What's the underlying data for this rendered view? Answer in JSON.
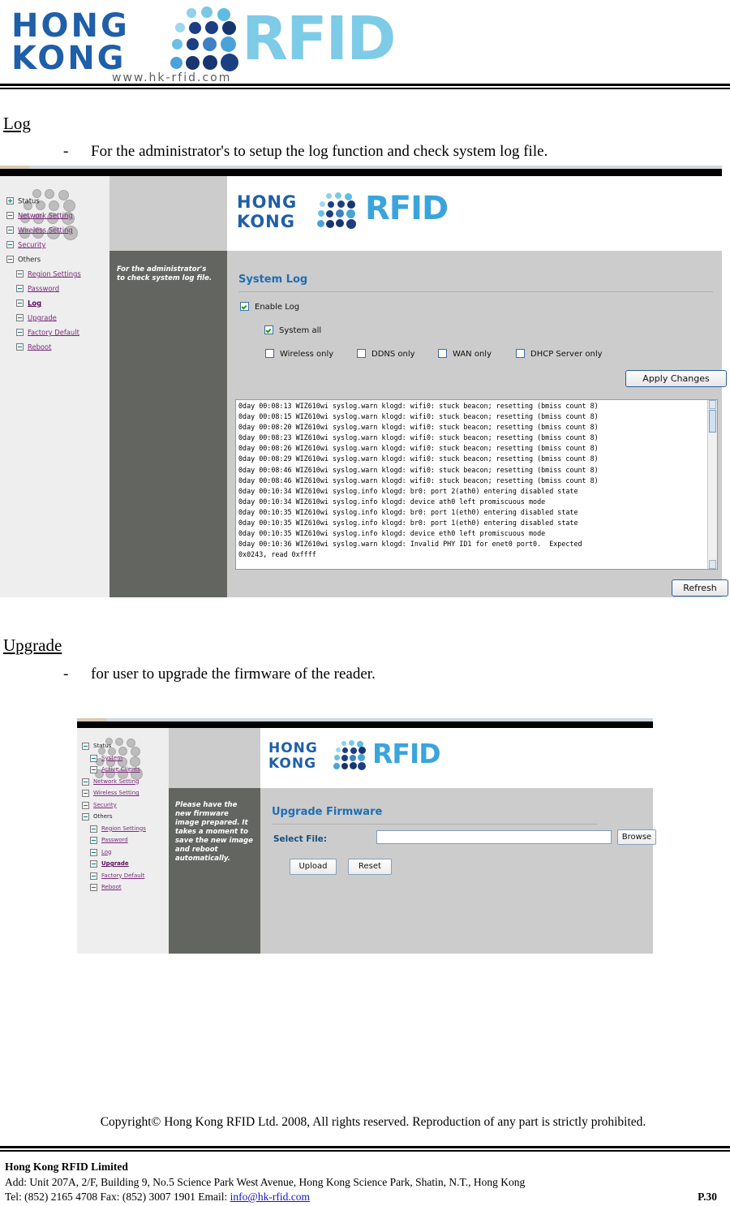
{
  "letterhead": {
    "line1": "HONG",
    "line2": "KONG",
    "brand": "RFID",
    "url": "www.hk-rfid.com"
  },
  "sections": [
    {
      "heading": "Log",
      "bullet_marker": "-",
      "bullet": "For the administrator's to setup the log function and check system log file."
    },
    {
      "heading": "Upgrade",
      "bullet_marker": "-",
      "bullet": "for user to upgrade the firmware of the reader."
    }
  ],
  "log_screenshot": {
    "logo": {
      "line1": "HONG",
      "line2": "KONG",
      "brand": "RFID"
    },
    "nav": [
      {
        "label": "Status",
        "icon": "plus-expand-icon",
        "style": "plain",
        "indent": 0
      },
      {
        "label": "Network Setting",
        "icon": "minus-collapse-icon",
        "style": "link",
        "indent": 0
      },
      {
        "label": "Wireless Setting",
        "icon": "minus-collapse-icon",
        "style": "link",
        "indent": 0
      },
      {
        "label": "Security",
        "icon": "minus-collapse-icon",
        "style": "link",
        "indent": 0
      },
      {
        "label": "Others",
        "icon": "minus-collapse-icon",
        "style": "plain",
        "indent": 0
      },
      {
        "label": "Region Settings",
        "icon": "minus-collapse-icon",
        "style": "link",
        "indent": 1
      },
      {
        "label": "Password",
        "icon": "minus-collapse-icon",
        "style": "link",
        "indent": 1
      },
      {
        "label": "Log",
        "icon": "minus-collapse-icon",
        "style": "current",
        "indent": 1
      },
      {
        "label": "Upgrade",
        "icon": "minus-collapse-icon",
        "style": "link",
        "indent": 1
      },
      {
        "label": "Factory Default",
        "icon": "minus-collapse-icon",
        "style": "link",
        "indent": 1
      },
      {
        "label": "Reboot",
        "icon": "minus-collapse-icon",
        "style": "link",
        "indent": 1
      }
    ],
    "hint": "For the administrator's to check system log file.",
    "panel_title": "System Log",
    "checkboxes": [
      {
        "label": "Enable Log",
        "checked": true
      },
      {
        "label": "System all",
        "checked": true
      },
      {
        "label": "Wireless only",
        "checked": false
      },
      {
        "label": "DDNS only",
        "checked": false
      },
      {
        "label": "WAN only",
        "checked": false
      },
      {
        "label": "DHCP Server only",
        "checked": false
      }
    ],
    "apply_button": "Apply Changes",
    "refresh_button": "Refresh",
    "log_lines": [
      "0day 00:08:13 WIZ610wi syslog.warn klogd: wifi0: stuck beacon; resetting (bmiss count 8)",
      "0day 00:08:15 WIZ610wi syslog.warn klogd: wifi0: stuck beacon; resetting (bmiss count 8)",
      "0day 00:08:20 WIZ610wi syslog.warn klogd: wifi0: stuck beacon; resetting (bmiss count 8)",
      "0day 00:08:23 WIZ610wi syslog.warn klogd: wifi0: stuck beacon; resetting (bmiss count 8)",
      "0day 00:08:26 WIZ610wi syslog.warn klogd: wifi0: stuck beacon; resetting (bmiss count 8)",
      "0day 00:08:29 WIZ610wi syslog.warn klogd: wifi0: stuck beacon; resetting (bmiss count 8)",
      "0day 00:08:46 WIZ610wi syslog.warn klogd: wifi0: stuck beacon; resetting (bmiss count 8)",
      "0day 00:08:46 WIZ610wi syslog.warn klogd: wifi0: stuck beacon; resetting (bmiss count 8)",
      "0day 00:10:34 WIZ610wi syslog.info klogd: br0: port 2(ath0) entering disabled state",
      "0day 00:10:34 WIZ610wi syslog.info klogd: device ath0 left promiscuous mode",
      "0day 00:10:35 WIZ610wi syslog.info klogd: br0: port 1(eth0) entering disabled state",
      "0day 00:10:35 WIZ610wi syslog.info klogd: br0: port 1(eth0) entering disabled state",
      "0day 00:10:35 WIZ610wi syslog.info klogd: device eth0 left promiscuous mode",
      "0day 00:10:36 WIZ610wi syslog.warn klogd: Invalid PHY ID1 for enet0 port0.  Expected",
      "0x0243, read 0xffff"
    ]
  },
  "upgrade_screenshot": {
    "logo": {
      "line1": "HONG",
      "line2": "KONG",
      "brand": "RFID"
    },
    "nav": [
      {
        "label": "Status",
        "icon": "minus-collapse-icon",
        "style": "plain",
        "indent": 0
      },
      {
        "label": "System",
        "icon": "minus-collapse-icon",
        "style": "link",
        "indent": 1
      },
      {
        "label": "Active Clients",
        "icon": "minus-collapse-icon",
        "style": "link",
        "indent": 1
      },
      {
        "label": "Network Setting",
        "icon": "minus-collapse-icon",
        "style": "link",
        "indent": 0
      },
      {
        "label": "Wireless Setting",
        "icon": "minus-collapse-icon",
        "style": "link",
        "indent": 0
      },
      {
        "label": "Security",
        "icon": "minus-collapse-icon",
        "style": "link",
        "indent": 0
      },
      {
        "label": "Others",
        "icon": "minus-collapse-icon",
        "style": "plain",
        "indent": 0
      },
      {
        "label": "Region Settings",
        "icon": "minus-collapse-icon",
        "style": "link",
        "indent": 1
      },
      {
        "label": "Password",
        "icon": "minus-collapse-icon",
        "style": "link",
        "indent": 1
      },
      {
        "label": "Log",
        "icon": "minus-collapse-icon",
        "style": "link",
        "indent": 1
      },
      {
        "label": "Upgrade",
        "icon": "minus-collapse-icon",
        "style": "current",
        "indent": 1
      },
      {
        "label": "Factory Default",
        "icon": "minus-collapse-icon",
        "style": "link",
        "indent": 1
      },
      {
        "label": "Reboot",
        "icon": "minus-collapse-icon",
        "style": "link",
        "indent": 1
      }
    ],
    "hint": "Please have the new firmware image prepared. It takes a moment to save the new image and reboot automatically.",
    "panel_title": "Upgrade Firmware",
    "select_file_label": "Select File:",
    "select_file_value": "",
    "browse_button": "Browse",
    "upload_button": "Upload",
    "reset_button": "Reset"
  },
  "footer": {
    "copyright": "Copyright© Hong Kong RFID Ltd. 2008, All rights reserved. Reproduction of any part is strictly prohibited.",
    "company": "Hong Kong RFID Limited",
    "address": "Add: Unit 207A, 2/F, Building 9, No.5 Science Park West Avenue, Hong Kong Science Park, Shatin, N.T., Hong Kong",
    "contact_prefix": "Tel: (852) 2165 4708   Fax: (852) 3007 1901   Email: ",
    "email": "info@hk-rfid.com",
    "page": "P.30"
  },
  "colors": {
    "brand_blue": "#1f5fa9",
    "brand_cyan": "#7ecbe8",
    "panel_title": "#1f6eb4",
    "nav_link": "#7b2a7b",
    "hint_bg": "#636560"
  }
}
